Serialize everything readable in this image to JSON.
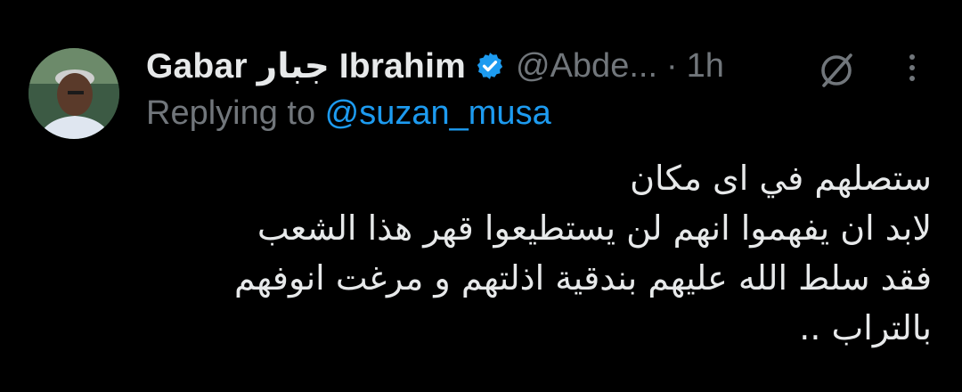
{
  "tweet": {
    "author": {
      "display_name": "Gabar جبار Ibrahim",
      "handle": "@Abde...",
      "verified": true
    },
    "separator": "·",
    "time": "1h",
    "replying_prefix": "Replying to ",
    "replying_mention": "@suzan_musa",
    "body_lines": [
      "ستصلهم في اى مكان",
      "لابد ان يفهموا انهم لن يستطيعوا قهر هذا الشعب",
      "فقد سلط الله عليهم بندقية اذلتهم و مرغت انوفهم",
      "بالتراب .."
    ]
  },
  "icons": {
    "verified": "verified-badge-icon",
    "grok": "grok-icon",
    "more": "more-options-icon"
  },
  "colors": {
    "background": "#000000",
    "primary_text": "#e7e9ea",
    "secondary_text": "#71767b",
    "accent": "#1d9bf0"
  }
}
